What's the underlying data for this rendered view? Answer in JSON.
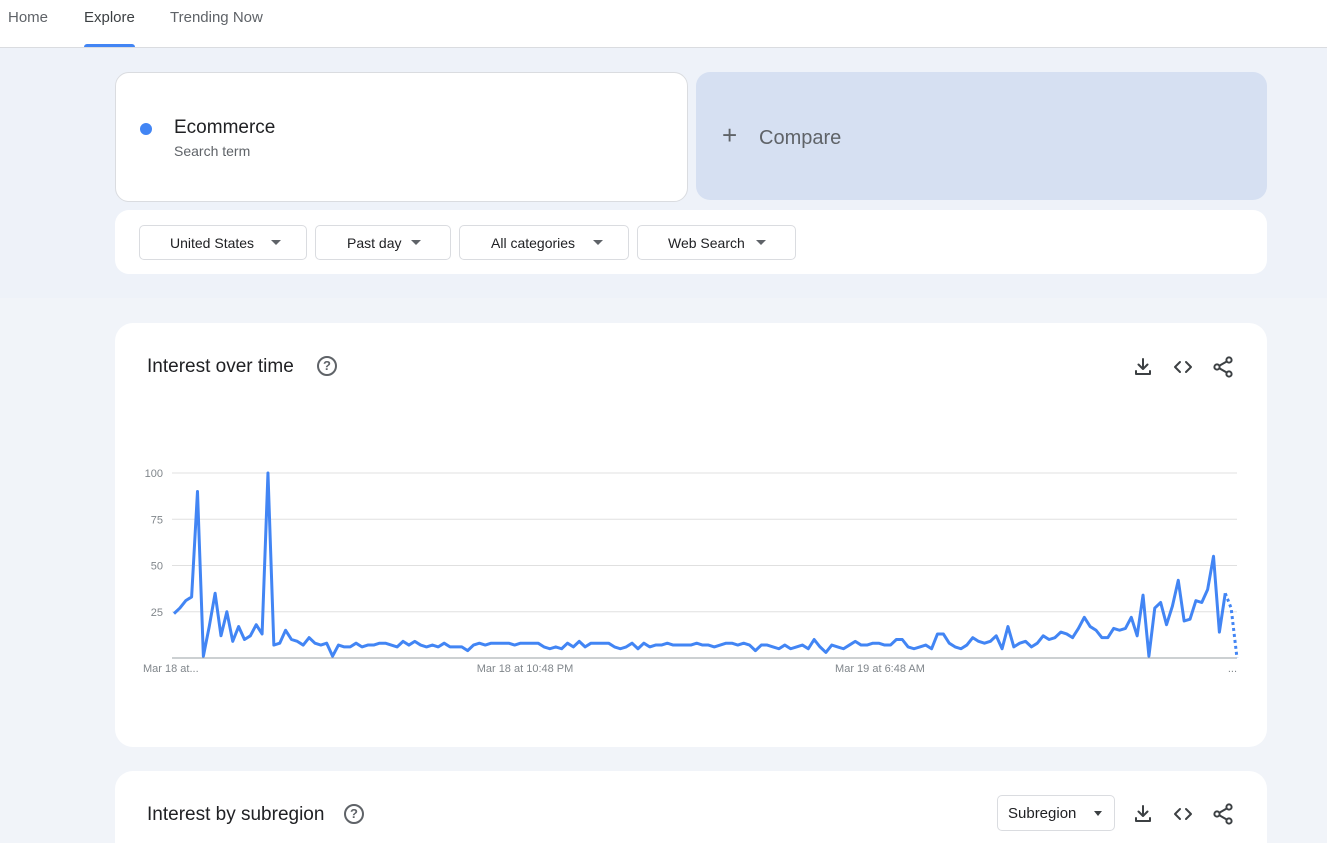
{
  "nav": {
    "tabs": [
      {
        "label": "Home"
      },
      {
        "label": "Explore"
      },
      {
        "label": "Trending Now"
      }
    ],
    "active": "Explore"
  },
  "search": {
    "term": "Ecommerce",
    "term_type": "Search term",
    "term_color": "#4285f4",
    "compare_label": "Compare"
  },
  "filters": {
    "region": "United States",
    "time": "Past day",
    "category": "All categories",
    "property": "Web Search"
  },
  "interest_over_time": {
    "title": "Interest over time"
  },
  "interest_by_subregion": {
    "title": "Interest by subregion",
    "select_label": "Subregion"
  },
  "colors": {
    "accent": "#4285f4",
    "band": "#eef2f9",
    "compare": "#d6e0f2"
  },
  "chart_data": {
    "type": "line",
    "ylim": [
      0,
      100
    ],
    "yticks": [
      25,
      50,
      75,
      100
    ],
    "xtick_labels": [
      "Mar 18 at...",
      "Mar 18 at 10:48 PM",
      "Mar 19 at 6:48 AM",
      "..."
    ],
    "grid": true,
    "series": [
      {
        "color": "#4285f4",
        "values": [
          24,
          27,
          31,
          33,
          90,
          1,
          17,
          35,
          12,
          25,
          9,
          17,
          10,
          12,
          18,
          13,
          100,
          7,
          8,
          15,
          10,
          9,
          7,
          11,
          8,
          7,
          8,
          1,
          7,
          6,
          6,
          8,
          6,
          7,
          7,
          8,
          8,
          7,
          6,
          9,
          7,
          9,
          7,
          6,
          7,
          6,
          8,
          6,
          6,
          6,
          4,
          7,
          8,
          7,
          8,
          8,
          8,
          8,
          7,
          8,
          8,
          8,
          8,
          6,
          5,
          6,
          5,
          8,
          6,
          9,
          6,
          8,
          8,
          8,
          8,
          6,
          5,
          6,
          8,
          5,
          8,
          6,
          7,
          7,
          8,
          7,
          7,
          7,
          7,
          8,
          7,
          7,
          6,
          7,
          8,
          8,
          7,
          8,
          7,
          4,
          7,
          7,
          6,
          5,
          7,
          5,
          6,
          7,
          5,
          10,
          6,
          3,
          7,
          6,
          5,
          7,
          9,
          7,
          7,
          8,
          8,
          7,
          7,
          10,
          10,
          6,
          5,
          6,
          7,
          5,
          13,
          13,
          8,
          6,
          5,
          7,
          11,
          9,
          8,
          9,
          12,
          5,
          17,
          6,
          8,
          9,
          6,
          8,
          12,
          10,
          11,
          14,
          13,
          11,
          16,
          22,
          17,
          15,
          11,
          11,
          16,
          15,
          16,
          22,
          12,
          34,
          1,
          27,
          30,
          18,
          28,
          42,
          20,
          21,
          31,
          30,
          37,
          55,
          14,
          35,
          27,
          0
        ],
        "last_points_partial": 2
      }
    ]
  }
}
